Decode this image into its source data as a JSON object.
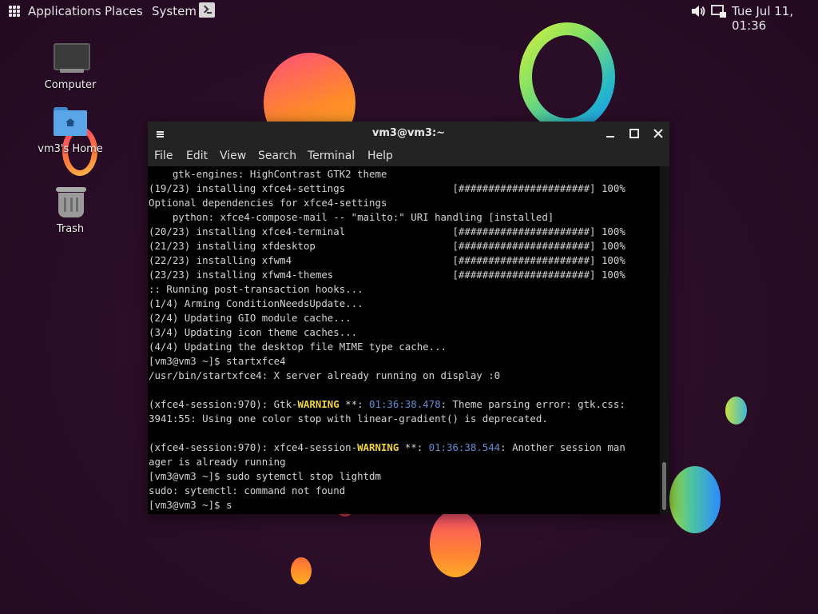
{
  "panel": {
    "menus": [
      "Applications",
      "Places",
      "System"
    ],
    "clock": "Tue Jul 11, 01:36"
  },
  "desktop": {
    "icons": [
      {
        "label": "Computer",
        "icon": "computer-icon"
      },
      {
        "label": "vm3's Home",
        "icon": "home-folder-icon"
      },
      {
        "label": "Trash",
        "icon": "trash-icon"
      }
    ]
  },
  "terminal": {
    "title": "vm3@vm3:~",
    "menu": [
      "File",
      "Edit",
      "View",
      "Search",
      "Terminal",
      "Help"
    ],
    "lines": [
      [
        "    gtk-engines: HighContrast GTK2 theme"
      ],
      [
        "(19/23) installing xfce4-settings                  [######################] 100%"
      ],
      [
        "Optional dependencies for xfce4-settings"
      ],
      [
        "    python: xfce4-compose-mail -- \"mailto:\" URI handling [installed]"
      ],
      [
        "(20/23) installing xfce4-terminal                  [######################] 100%"
      ],
      [
        "(21/23) installing xfdesktop                       [######################] 100%"
      ],
      [
        "(22/23) installing xfwm4                           [######################] 100%"
      ],
      [
        "(23/23) installing xfwm4-themes                    [######################] 100%"
      ],
      [
        ":: Running post-transaction hooks..."
      ],
      [
        "(1/4) Arming ConditionNeedsUpdate..."
      ],
      [
        "(2/4) Updating GIO module cache..."
      ],
      [
        "(3/4) Updating icon theme caches..."
      ],
      [
        "(4/4) Updating the desktop file MIME type cache..."
      ],
      [
        "[vm3@vm3 ~]$ startxfce4"
      ],
      [
        "/usr/bin/startxfce4: X server already running on display :0"
      ],
      [
        ""
      ],
      [
        "(xfce4-session:970): Gtk-",
        "WARNING",
        " **: ",
        "01:36:38.478",
        ": Theme parsing error: gtk.css:"
      ],
      [
        "3941:55: Using one color stop with linear-gradient() is deprecated."
      ],
      [
        ""
      ],
      [
        "(xfce4-session:970): xfce4-session-",
        "WARNING",
        " **: ",
        "01:36:38.544",
        ": Another session man"
      ],
      [
        "ager is already running"
      ],
      [
        "[vm3@vm3 ~]$ sudo sytemctl stop lightdm"
      ],
      [
        "sudo: sytemctl: command not found"
      ],
      [
        "[vm3@vm3 ~]$ s"
      ]
    ]
  },
  "colors": {
    "warning": "#f2d43a",
    "timestamp": "#5f8fd6",
    "terminal_text": "#d4d4d4",
    "titlebar": "#232323"
  }
}
